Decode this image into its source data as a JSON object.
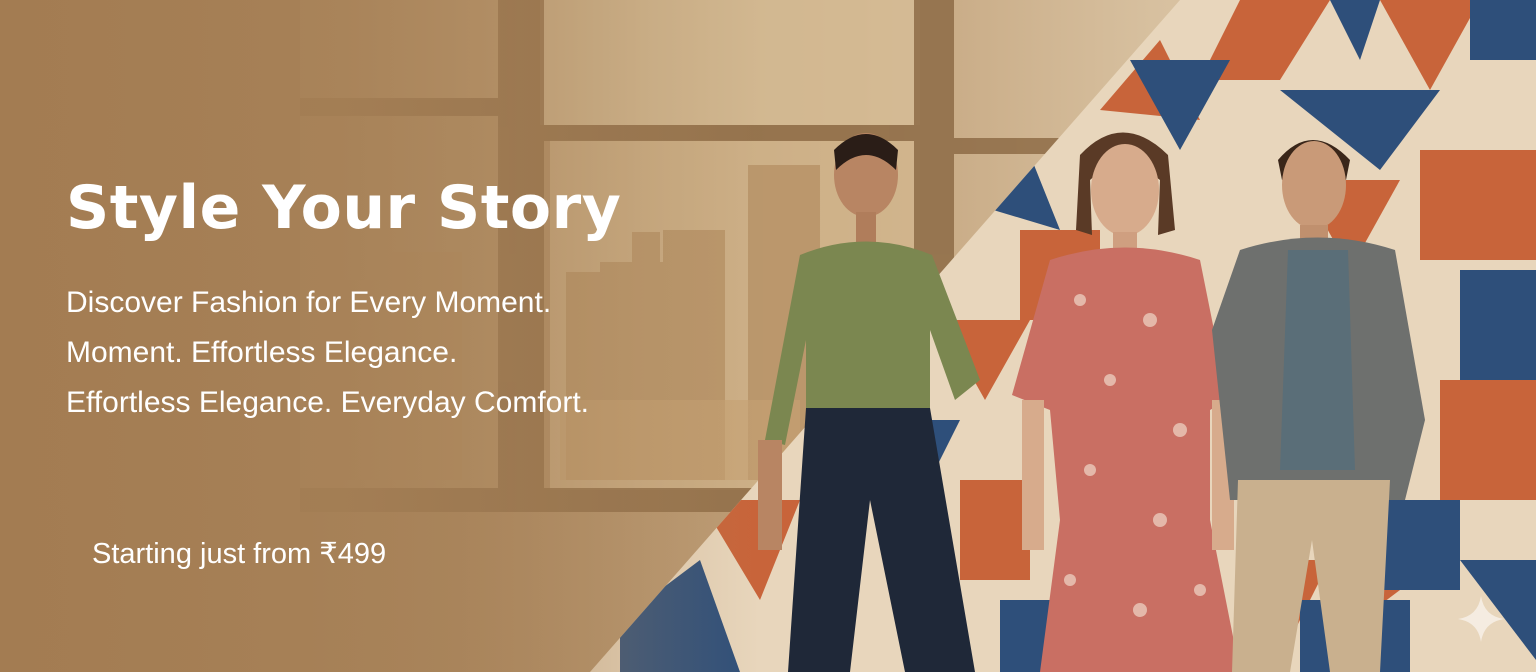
{
  "banner": {
    "headline": "Style Your Story",
    "tagline": [
      "Discover Fashion for Every Moment.",
      "Moment. Effortless Elegance.",
      "Effortless Elegance. Everyday Comfort."
    ],
    "price_text": "Starting just from ₹499"
  },
  "colors": {
    "background": "#a9855d",
    "text": "#ffffff",
    "pattern_orange": "#c8643a",
    "pattern_blue": "#2e4f7a",
    "pattern_cream": "#e8d6bc"
  },
  "icons": {
    "corner": "sparkle-icon"
  }
}
